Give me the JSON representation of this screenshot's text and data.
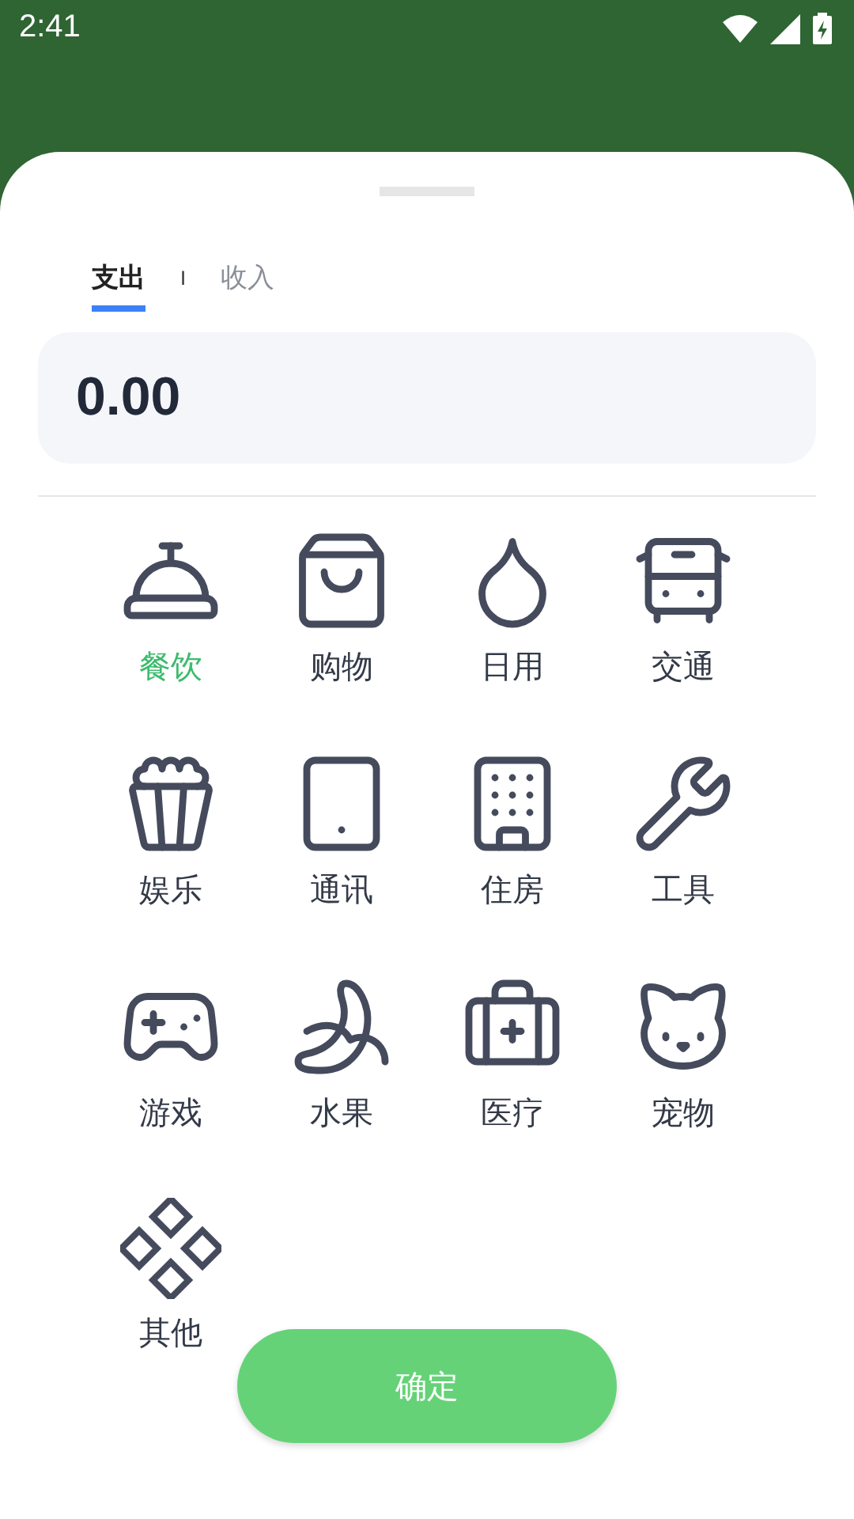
{
  "status_bar": {
    "time": "2:41"
  },
  "tabs": [
    {
      "label": "支出",
      "selected": true
    },
    {
      "label": "收入",
      "selected": false
    }
  ],
  "tab_separator": "I",
  "amount": "0.00",
  "categories": [
    {
      "label": "餐饮",
      "selected": true
    },
    {
      "label": "购物",
      "selected": false
    },
    {
      "label": "日用",
      "selected": false
    },
    {
      "label": "交通",
      "selected": false
    },
    {
      "label": "娱乐",
      "selected": false
    },
    {
      "label": "通讯",
      "selected": false
    },
    {
      "label": "住房",
      "selected": false
    },
    {
      "label": "工具",
      "selected": false
    },
    {
      "label": "游戏",
      "selected": false
    },
    {
      "label": "水果",
      "selected": false
    },
    {
      "label": "医疗",
      "selected": false
    },
    {
      "label": "宠物",
      "selected": false
    },
    {
      "label": "其他",
      "selected": false
    }
  ],
  "confirm_button": "确定"
}
